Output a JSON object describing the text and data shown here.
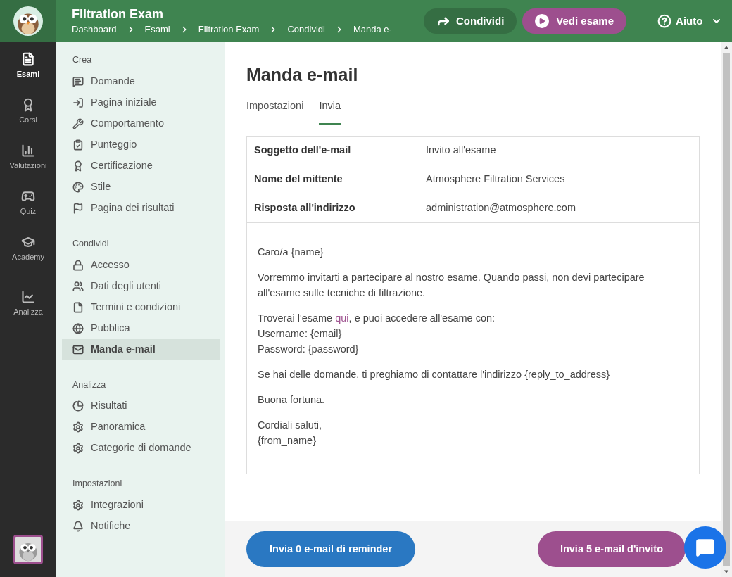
{
  "header": {
    "title": "Filtration Exam",
    "breadcrumbs": [
      "Dashboard",
      "Esami",
      "Filtration Exam",
      "Condividi",
      "Manda e-"
    ],
    "share_button": "Condividi",
    "view_button": "Vedi esame",
    "help_menu": "Aiuto"
  },
  "rail": [
    {
      "label": "Esami",
      "selected": true
    },
    {
      "label": "Corsi",
      "selected": false
    },
    {
      "label": "Valutazioni",
      "selected": false
    },
    {
      "label": "Quiz",
      "selected": false
    },
    {
      "label": "Academy",
      "selected": false
    },
    {
      "label": "Analizza",
      "selected": false
    }
  ],
  "sidebar": {
    "sections": [
      {
        "title": "Crea",
        "items": [
          {
            "label": "Domande",
            "selected": false
          },
          {
            "label": "Pagina iniziale",
            "selected": false
          },
          {
            "label": "Comportamento",
            "selected": false
          },
          {
            "label": "Punteggio",
            "selected": false
          },
          {
            "label": "Certificazione",
            "selected": false
          },
          {
            "label": "Stile",
            "selected": false
          },
          {
            "label": "Pagina dei risultati",
            "selected": false
          }
        ]
      },
      {
        "title": "Condividi",
        "items": [
          {
            "label": "Accesso",
            "selected": false
          },
          {
            "label": "Dati degli utenti",
            "selected": false
          },
          {
            "label": "Termini e condizioni",
            "selected": false
          },
          {
            "label": "Pubblica",
            "selected": false
          },
          {
            "label": "Manda e-mail",
            "selected": true
          }
        ]
      },
      {
        "title": "Analizza",
        "items": [
          {
            "label": "Risultati",
            "selected": false
          },
          {
            "label": "Panoramica",
            "selected": false
          },
          {
            "label": "Categorie di domande",
            "selected": false
          }
        ]
      },
      {
        "title": "Impostazioni",
        "items": [
          {
            "label": "Integrazioni",
            "selected": false
          },
          {
            "label": "Notifiche",
            "selected": false
          }
        ]
      }
    ]
  },
  "page": {
    "title": "Manda e-mail",
    "tabs": [
      {
        "label": "Impostazioni",
        "selected": false
      },
      {
        "label": "Invia",
        "selected": true
      }
    ],
    "fields": [
      {
        "label": "Soggetto dell'e-mail",
        "value": "Invito all'esame"
      },
      {
        "label": "Nome del mittente",
        "value": "Atmosphere Filtration Services"
      },
      {
        "label": "Risposta all'indirizzo",
        "value": "administration@atmosphere.com"
      }
    ],
    "body": [
      {
        "lines": [
          [
            {
              "kind": "text",
              "text": "Caro/a {name}"
            }
          ]
        ]
      },
      {
        "lines": [
          [
            {
              "kind": "text",
              "text": "Vorremmo invitarti a partecipare al nostro esame. Quando passi, non devi partecipare all'esame sulle tecniche di filtrazione."
            }
          ]
        ]
      },
      {
        "lines": [
          [
            {
              "kind": "text",
              "text": "Troverai l'esame "
            },
            {
              "kind": "link",
              "text": "qui"
            },
            {
              "kind": "text",
              "text": ", e puoi accedere all'esame con:"
            }
          ],
          [
            {
              "kind": "text",
              "text": "Username: {email}"
            }
          ],
          [
            {
              "kind": "text",
              "text": "Password: {password}"
            }
          ]
        ]
      },
      {
        "lines": [
          [
            {
              "kind": "text",
              "text": "Se hai delle domande, ti preghiamo di contattare l'indirizzo {reply_to_address}"
            }
          ]
        ]
      },
      {
        "lines": [
          [
            {
              "kind": "text",
              "text": "Buona fortuna."
            }
          ]
        ]
      },
      {
        "lines": [
          [
            {
              "kind": "text",
              "text": "Cordiali saluti,"
            }
          ],
          [
            {
              "kind": "text",
              "text": "{from_name}"
            }
          ]
        ]
      }
    ]
  },
  "footer": {
    "reminder_button": "Invia 0 e-mail di reminder",
    "invite_button": "Invia 5 e-mail d'invito"
  }
}
